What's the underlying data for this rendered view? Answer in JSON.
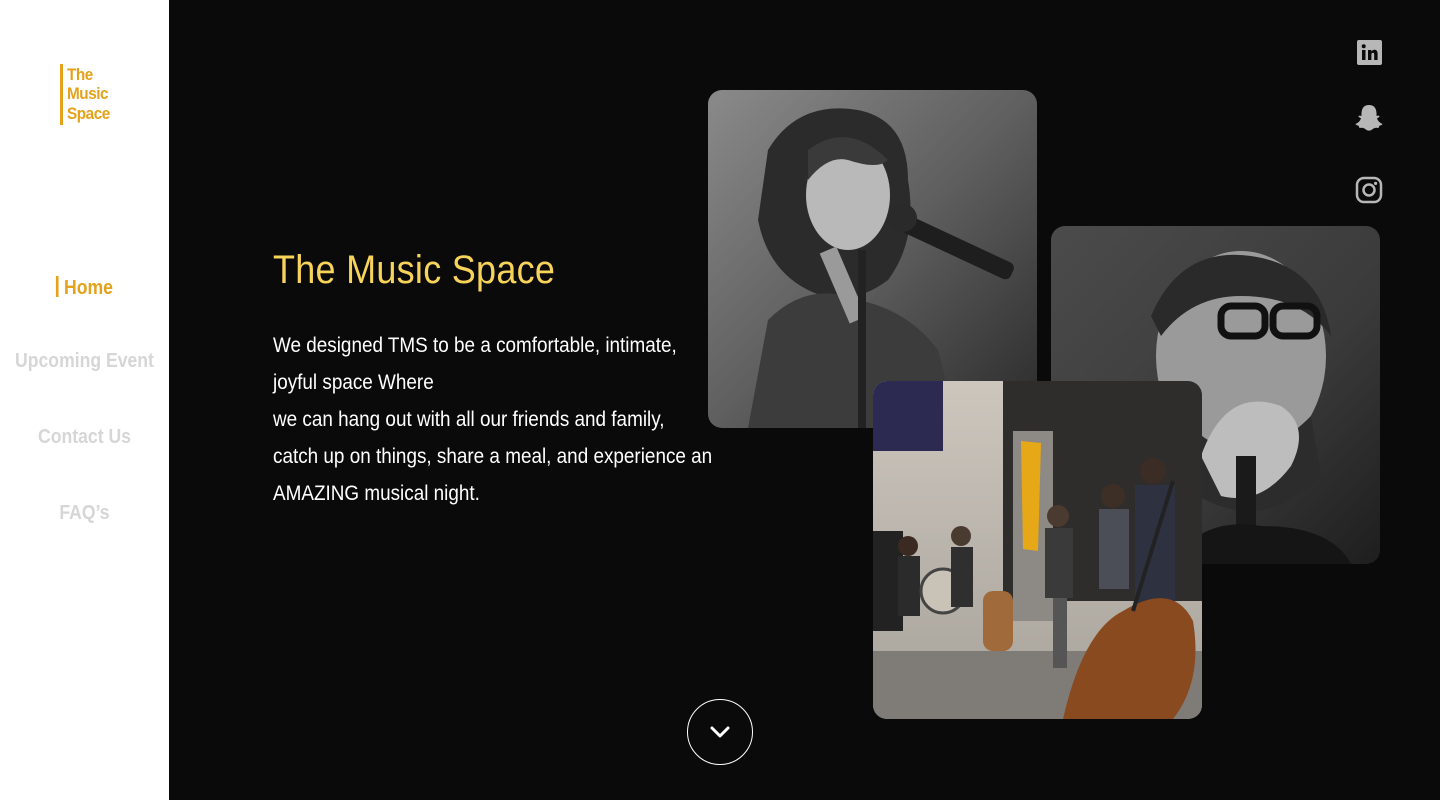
{
  "brand": {
    "logo_lines": [
      "The",
      "Music",
      "Space"
    ],
    "accent_color": "#e3a21a",
    "title_color": "#f7d35a",
    "background_color": "#0b0a0a"
  },
  "nav": {
    "items": [
      {
        "label": "Home",
        "active": true
      },
      {
        "label": "Upcoming Event",
        "active": false
      },
      {
        "label": "Contact Us",
        "active": false
      },
      {
        "label": "FAQ’s",
        "active": false
      }
    ]
  },
  "hero": {
    "title": "The Music Space",
    "paragraph_lines": [
      "We designed TMS to be a comfortable, intimate,",
      "joyful space Where",
      "we can hang out with all our friends and family,",
      "catch up on things, share a meal, and experience an",
      "AMAZING musical night."
    ]
  },
  "photos": [
    {
      "subject": "female-singer-at-microphone",
      "style": "black-and-white"
    },
    {
      "subject": "male-beatboxer-with-microphone",
      "style": "black-and-white"
    },
    {
      "subject": "live-band-performance",
      "style": "color"
    }
  ],
  "social": [
    {
      "icon": "linkedin-icon"
    },
    {
      "icon": "snapchat-icon"
    },
    {
      "icon": "instagram-icon"
    }
  ],
  "scroll_button": {
    "icon": "chevron-down-icon"
  }
}
